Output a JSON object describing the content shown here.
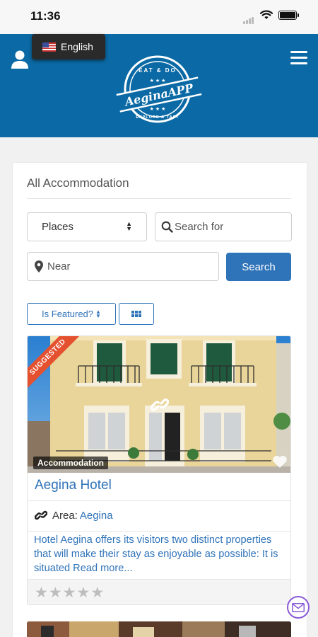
{
  "status": {
    "time": "11:36"
  },
  "header": {
    "language": "English",
    "logo": {
      "top": "EAT & DO",
      "name": "AeginaAPP",
      "bottom": "EXPLORE & TAST"
    }
  },
  "main": {
    "title": "All Accommodation",
    "filters": {
      "places_label": "Places",
      "search_placeholder": "Search for",
      "near_placeholder": "Near",
      "search_button": "Search",
      "featured_label": "Is Featured?"
    },
    "listing": {
      "ribbon": "SUGGESTED",
      "category": "Accommodation",
      "title": "Aegina Hotel",
      "area_label": "Area:",
      "area_value": "Aegina",
      "description": "Hotel Aegina offers its visitors two distinct properties that will make their stay as enjoyable as possible: It is situated Read more...",
      "rating": 0,
      "max_rating": 5
    }
  },
  "colors": {
    "header": "#0b6aa5",
    "accent": "#2f73b9",
    "ribbon": "#e5502f"
  },
  "icons": [
    "user-icon",
    "menu-icon",
    "search-icon",
    "map-marker-icon",
    "grid-icon",
    "link-icon",
    "heart-icon",
    "star-icon",
    "mail-icon"
  ]
}
